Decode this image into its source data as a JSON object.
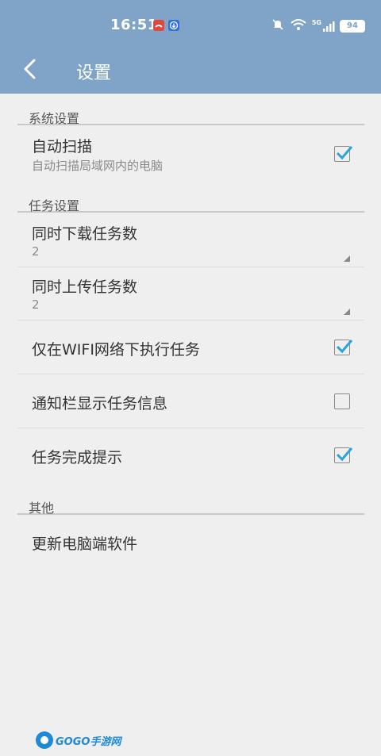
{
  "status_bar": {
    "time": "16:51",
    "battery": "94",
    "signal_label": "5G"
  },
  "header": {
    "title": "设置"
  },
  "sections": [
    {
      "title": "系统设置",
      "items": [
        {
          "label": "自动扫描",
          "sub": "自动扫描局域网内的电脑",
          "checked": true
        }
      ]
    },
    {
      "title": "任务设置",
      "items": [
        {
          "label": "同时下载任务数",
          "value": "2"
        },
        {
          "label": "同时上传任务数",
          "value": "2"
        },
        {
          "label": "仅在WIFI网络下执行任务",
          "checked": true
        },
        {
          "label": "通知栏显示任务信息",
          "checked": false
        },
        {
          "label": "任务完成提示",
          "checked": true
        }
      ]
    },
    {
      "title": "其他",
      "items": [
        {
          "label": "更新电脑端软件"
        }
      ]
    }
  ],
  "watermark": {
    "text": "GOGO手游网"
  },
  "colors": {
    "header_bg": "#7fa4c7",
    "check_accent": "#2ea3d8",
    "background": "#efefef"
  }
}
